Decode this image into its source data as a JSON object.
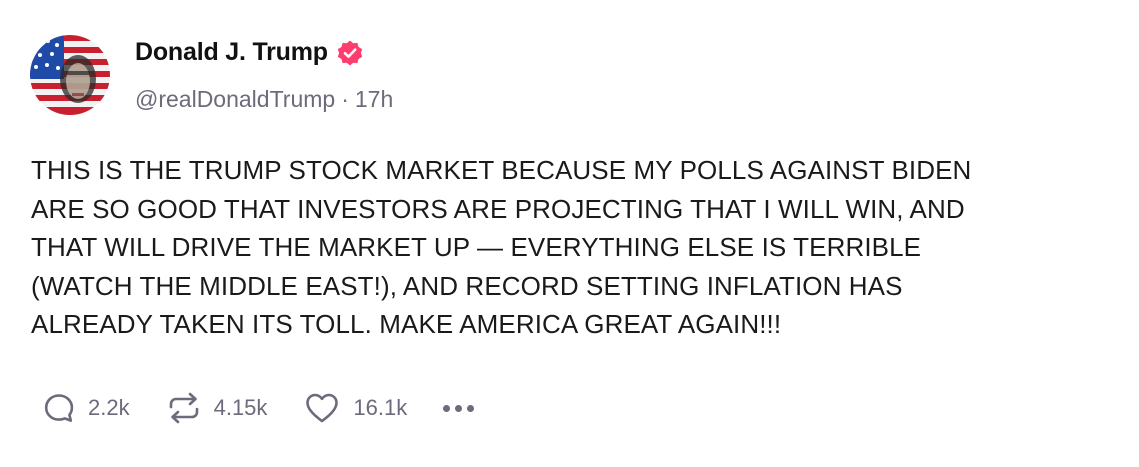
{
  "author": {
    "display_name": "Donald J. Trump",
    "handle": "@realDonaldTrump",
    "separator": "·",
    "timestamp": "17h",
    "verified": true,
    "verified_color": "#ff3d6e"
  },
  "post": {
    "text": "THIS IS THE TRUMP STOCK MARKET BECAUSE MY POLLS AGAINST BIDEN\nARE SO GOOD THAT INVESTORS ARE PROJECTING THAT I WILL WIN, AND\nTHAT WILL DRIVE THE MARKET UP — EVERYTHING ELSE IS TERRIBLE\n(WATCH THE MIDDLE EAST!), AND RECORD SETTING INFLATION HAS\nALREADY TAKEN ITS TOLL. MAKE AMERICA GREAT AGAIN!!!"
  },
  "actions": {
    "replies": {
      "icon": "reply-icon",
      "count": "2.2k"
    },
    "reposts": {
      "icon": "repost-icon",
      "count": "4.15k"
    },
    "likes": {
      "icon": "heart-icon",
      "count": "16.1k"
    },
    "more": {
      "icon": "more-icon"
    }
  },
  "colors": {
    "text": "#1a1a1a",
    "muted": "#6b6b7b",
    "background": "#ffffff"
  }
}
